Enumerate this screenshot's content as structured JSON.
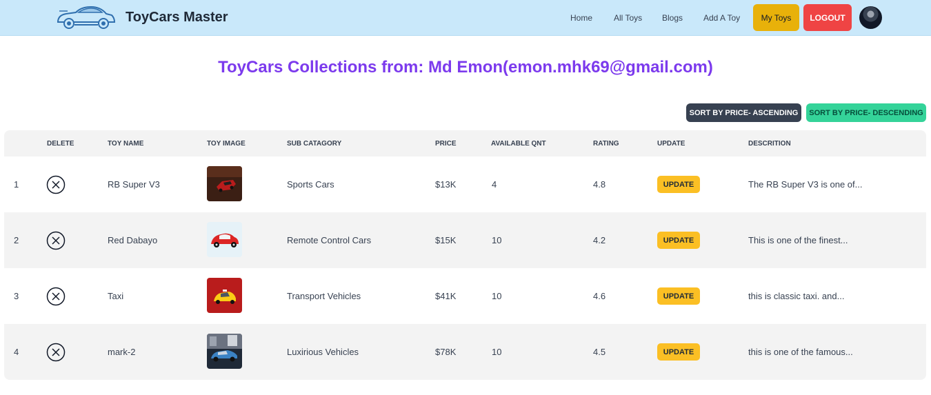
{
  "brand": {
    "title": "ToyCars Master",
    "logo_icon": "toy-car-logo-icon"
  },
  "nav": {
    "home": "Home",
    "all_toys": "All Toys",
    "blogs": "Blogs",
    "add_toy": "Add A Toy",
    "my_toys": "My Toys",
    "logout": "LOGOUT",
    "avatar_icon": "user-avatar-icon"
  },
  "page": {
    "title": "ToyCars Collections from: Md Emon(emon.mhk69@gmail.com)"
  },
  "sort": {
    "ascending": "SORT BY PRICE- ASCENDING",
    "descending": "SORT BY PRICE- DESCENDING"
  },
  "table": {
    "headers": [
      "DELETE",
      "TOY NAME",
      "TOY IMAGE",
      "SUB CATAGORY",
      "PRICE",
      "AVAILABLE QNT",
      "RATING",
      "UPDATE",
      "DESCRITION"
    ],
    "update_label": "UPDATE",
    "rows": [
      {
        "index": "1",
        "name": "RB Super V3",
        "image": "red-sports-car-photo",
        "sub_category": "Sports Cars",
        "price": "$13K",
        "quantity": "4",
        "rating": "4.8",
        "description": "The RB Super V3 is one of..."
      },
      {
        "index": "2",
        "name": "Red Dabayo",
        "image": "red-beetle-car-photo",
        "sub_category": "Remote Control Cars",
        "price": "$15K",
        "quantity": "10",
        "rating": "4.2",
        "description": "This is one of the finest..."
      },
      {
        "index": "3",
        "name": "Taxi",
        "image": "yellow-taxi-photo",
        "sub_category": "Transport Vehicles",
        "price": "$41K",
        "quantity": "10",
        "rating": "4.6",
        "description": "this is classic taxi. and..."
      },
      {
        "index": "4",
        "name": "mark-2",
        "image": "blue-vintage-car-photo",
        "sub_category": "Luxirious Vehicles",
        "price": "$78K",
        "quantity": "10",
        "rating": "4.5",
        "description": "this is one of the famous..."
      }
    ]
  },
  "colors": {
    "navbar": "#c9e8fa",
    "title": "#7c3aed",
    "my_toys": "#e8b10a",
    "logout": "#ef4444",
    "sort_asc": "#374151",
    "sort_desc": "#34d399",
    "update": "#fbbf24"
  }
}
